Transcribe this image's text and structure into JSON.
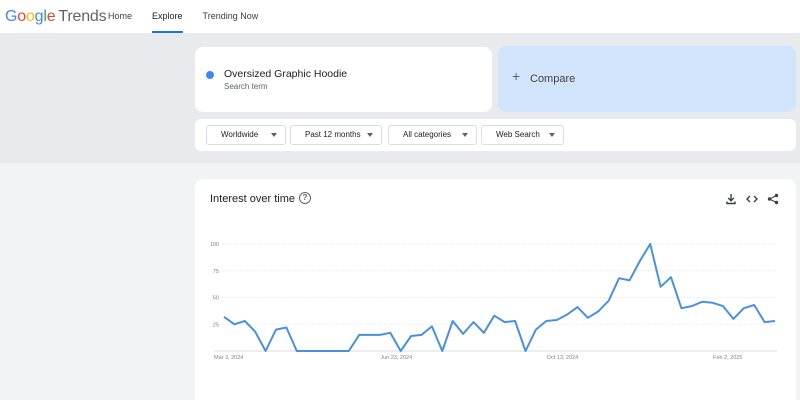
{
  "header": {
    "logo_google": [
      "G",
      "o",
      "o",
      "g",
      "l",
      "e"
    ],
    "logo_google_colors": [
      "#4285f4",
      "#ea4335",
      "#fbbc05",
      "#4285f4",
      "#34a853",
      "#ea4335"
    ],
    "logo_trends": "Trends",
    "tabs": [
      {
        "label": "Home",
        "active": false
      },
      {
        "label": "Explore",
        "active": true
      },
      {
        "label": "Trending Now",
        "active": false
      }
    ]
  },
  "search": {
    "term": "Oversized Graphic Hoodie",
    "term_sub": "Search term",
    "term_color": "#4285f4",
    "compare_label": "Compare"
  },
  "filters": [
    {
      "label": "Worldwide"
    },
    {
      "label": "Past 12 months"
    },
    {
      "label": "All categories"
    },
    {
      "label": "Web Search"
    }
  ],
  "chart": {
    "title": "Interest over time",
    "icons": [
      "help-icon",
      "download-icon",
      "embed-icon",
      "share-icon"
    ]
  },
  "chart_data": {
    "type": "line",
    "title": "Interest over time",
    "series": [
      {
        "color": "#4a90e2",
        "values": [
          32,
          25,
          28,
          18,
          0,
          20,
          22,
          0,
          0,
          0,
          0,
          0,
          0,
          15,
          15,
          15,
          17,
          0,
          14,
          15,
          23,
          0,
          28,
          16,
          27,
          17,
          33,
          27,
          28,
          0,
          20,
          28,
          29,
          34,
          41,
          31,
          37,
          47,
          68,
          66,
          84,
          100,
          60,
          69,
          40,
          42,
          46,
          45,
          42,
          30,
          40,
          43,
          27,
          28
        ]
      }
    ],
    "x_tick_labels": [
      "Mar 3, 2024",
      "Jun 23, 2024",
      "Oct 13, 2024",
      "Feb 2, 2025"
    ],
    "x_tick_indices": [
      0,
      16,
      32,
      48
    ],
    "y_ticks": [
      25,
      50,
      75,
      100
    ],
    "ylim": [
      0,
      100
    ],
    "grid": true
  }
}
